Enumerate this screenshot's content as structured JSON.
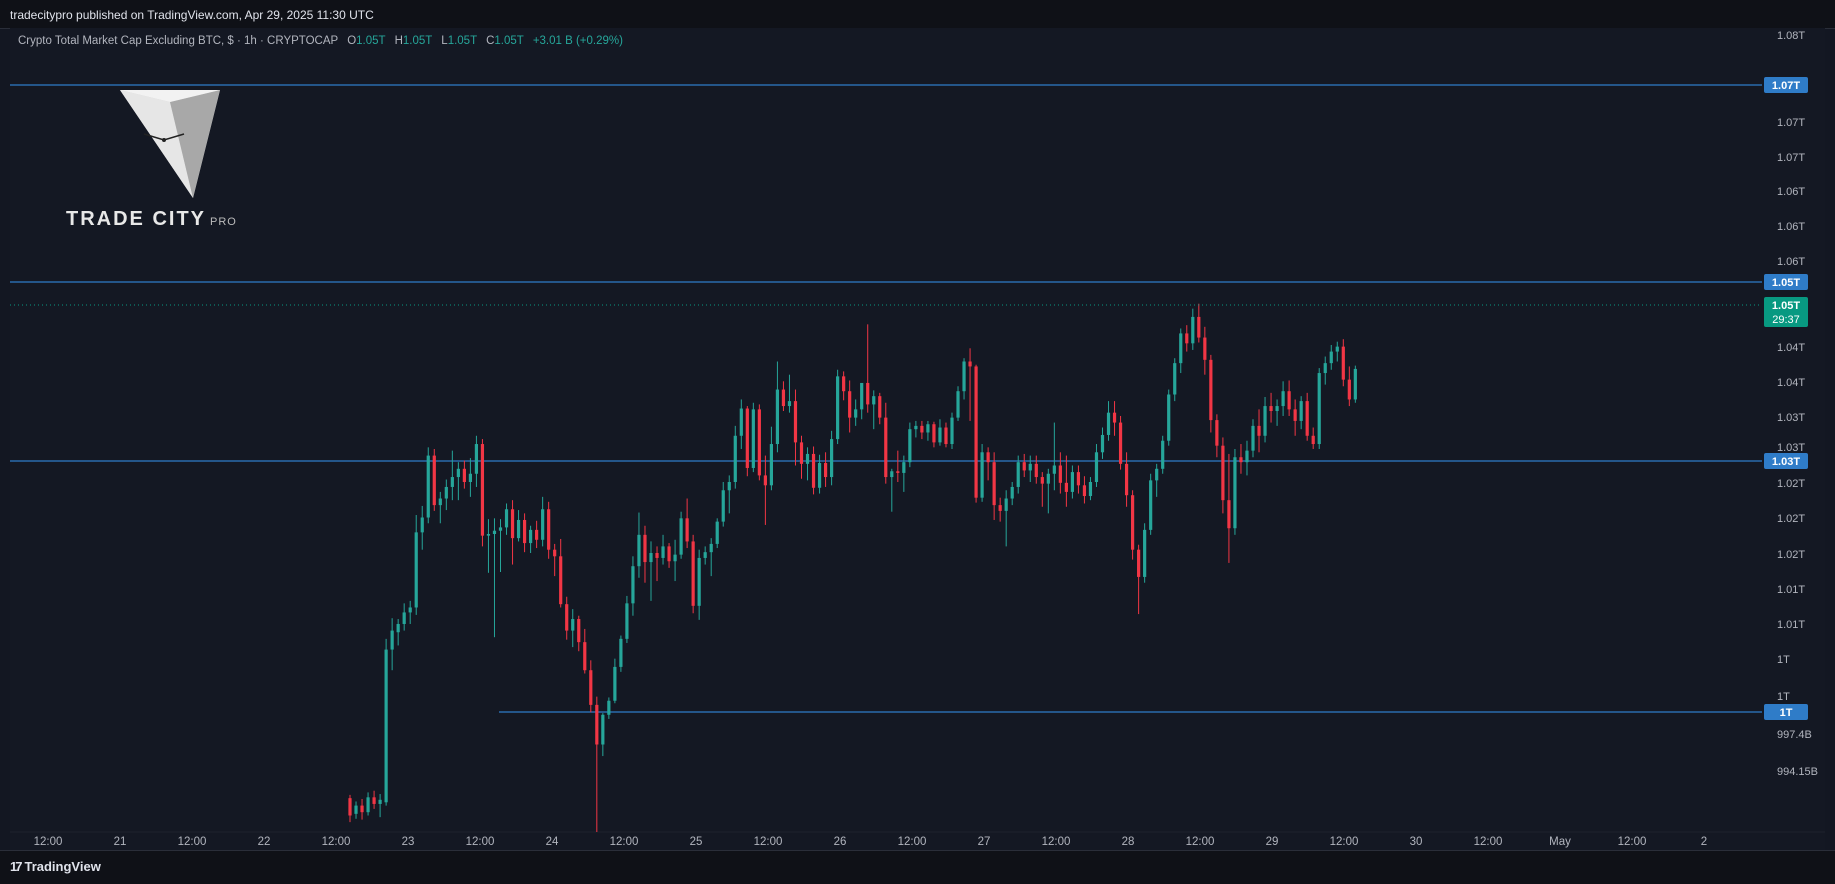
{
  "header": {
    "publisher": "tradecitypro published on TradingView.com, Apr 29, 2025 11:30 UTC"
  },
  "legend": {
    "symbol": "Crypto Total Market Cap Excluding BTC, $ · 1h · CRYPTOCAP",
    "o_label": "O",
    "o": "1.05T",
    "h_label": "H",
    "h": "1.05T",
    "l_label": "L",
    "l": "1.05T",
    "c_label": "C",
    "c": "1.05T",
    "change": "+3.01 B (+0.29%)"
  },
  "brand": {
    "name": "TRADE CITY",
    "sub": "PRO"
  },
  "footer": {
    "logo_text": "TradingView",
    "logo_mark": "17"
  },
  "colors": {
    "background": "#141823",
    "up": "#26a69a",
    "down": "#f23645",
    "level_line": "#2f7cc8",
    "label_blue": "#2f7cc8",
    "label_green": "#089981"
  },
  "chart_data": {
    "type": "candlestick",
    "title": "Crypto Total Market Cap Excluding BTC, $ · 1h · CRYPTOCAP",
    "x_tick_labels": [
      "12:00",
      "21",
      "12:00",
      "22",
      "12:00",
      "23",
      "12:00",
      "24",
      "12:00",
      "25",
      "12:00",
      "26",
      "12:00",
      "27",
      "12:00",
      "28",
      "12:00",
      "29",
      "12:00",
      "30",
      "12:00",
      "May",
      "12:00",
      "2"
    ],
    "y_tick_labels": [
      {
        "label": "1.08T",
        "value": 1.088
      },
      {
        "label": "1.08T",
        "value": 1.083
      },
      {
        "label": "1.07T",
        "value": 1.073
      },
      {
        "label": "1.07T",
        "value": 1.068
      },
      {
        "label": "1.06T",
        "value": 1.063
      },
      {
        "label": "1.06T",
        "value": 1.058
      },
      {
        "label": "1.06T",
        "value": 1.053
      },
      {
        "label": "1.05T",
        "value": 1.048
      },
      {
        "label": "1.04T",
        "value": 1.043
      },
      {
        "label": "1.04T",
        "value": 1.038
      },
      {
        "label": "1.03T",
        "value": 1.033
      },
      {
        "label": "1.03T",
        "value": 1.028
      },
      {
        "label": "1.02T",
        "value": 1.023
      },
      {
        "label": "1.02T",
        "value": 1.018
      },
      {
        "label": "1.02T",
        "value": 1.013
      },
      {
        "label": "1.01T",
        "value": 1.008
      },
      {
        "label": "1.01T",
        "value": 1.003
      },
      {
        "label": "1T",
        "value": 0.998
      },
      {
        "label": "1T",
        "value": 0.993
      },
      {
        "label": "997.4B",
        "value": 0.9974
      },
      {
        "label": "994.15B",
        "value": 0.99415
      }
    ],
    "horizontal_levels": [
      {
        "label": "1.07T",
        "value": 1.078,
        "start": "left"
      },
      {
        "label": "1.05T",
        "value": 1.051,
        "start": "left"
      },
      {
        "label": "1.03T",
        "value": 1.0265,
        "start": "left"
      },
      {
        "label": "1T",
        "value": 0.992,
        "start": "Apr 23 10:00"
      }
    ],
    "last_price": {
      "label": "1.05T",
      "countdown": "29:37",
      "value": 1.0477
    },
    "x_range_hours": [
      0,
      240
    ],
    "y_range": [
      0.9916,
      1.089
    ],
    "candles": [
      [
        60,
        0.9957,
        0.9961,
        0.9928,
        0.9936
      ],
      [
        61,
        0.9938,
        0.9953,
        0.9932,
        0.9948
      ],
      [
        62,
        0.9948,
        0.9956,
        0.9931,
        0.994
      ],
      [
        63,
        0.994,
        0.9964,
        0.9936,
        0.9958
      ],
      [
        64,
        0.9958,
        0.9966,
        0.9944,
        0.995
      ],
      [
        65,
        0.995,
        0.9962,
        0.9934,
        0.9955
      ],
      [
        66,
        0.9952,
        1.015,
        0.9948,
        1.0137
      ],
      [
        67,
        1.0137,
        1.0175,
        1.0112,
        1.016
      ],
      [
        68,
        1.0158,
        1.0174,
        1.0142,
        1.0168
      ],
      [
        69,
        1.0168,
        1.0193,
        1.016,
        1.0182
      ],
      [
        70,
        1.0182,
        1.0196,
        1.0168,
        1.0188
      ],
      [
        71,
        1.0188,
        1.03,
        1.0179,
        1.0279
      ],
      [
        72,
        1.0279,
        1.0311,
        1.0258,
        1.0297
      ],
      [
        73,
        1.0297,
        1.0382,
        1.029,
        1.0372
      ],
      [
        74,
        1.0372,
        1.038,
        1.0305,
        1.0312
      ],
      [
        75,
        1.0312,
        1.0328,
        1.029,
        1.032
      ],
      [
        76,
        1.032,
        1.0343,
        1.0306,
        1.0334
      ],
      [
        77,
        1.0334,
        1.0378,
        1.0318,
        1.0346
      ],
      [
        78,
        1.0346,
        1.0364,
        1.0318,
        1.0356
      ],
      [
        79,
        1.0356,
        1.0366,
        1.0332,
        1.034
      ],
      [
        80,
        1.034,
        1.0369,
        1.0322,
        1.035
      ],
      [
        81,
        1.035,
        1.0396,
        1.0334,
        1.0386
      ],
      [
        82,
        1.0386,
        1.0392,
        1.0262,
        1.0275
      ],
      [
        83,
        1.0275,
        1.0295,
        1.023,
        1.0277
      ],
      [
        84,
        1.0277,
        1.0296,
        1.0152,
        1.0281
      ],
      [
        85,
        1.0281,
        1.0295,
        1.0231,
        1.0285
      ],
      [
        86,
        1.0285,
        1.0314,
        1.0276,
        1.0307
      ],
      [
        87,
        1.0307,
        1.0318,
        1.024,
        1.0272
      ],
      [
        88,
        1.0272,
        1.0306,
        1.0268,
        1.0294
      ],
      [
        89,
        1.0294,
        1.0302,
        1.0255,
        1.0266
      ],
      [
        90,
        1.0266,
        1.0287,
        1.0254,
        1.0282
      ],
      [
        91,
        1.0282,
        1.0293,
        1.026,
        1.027
      ],
      [
        92,
        1.027,
        1.0322,
        1.0262,
        1.0307
      ],
      [
        93,
        1.0307,
        1.0316,
        1.0247,
        1.0258
      ],
      [
        94,
        1.0258,
        1.0265,
        1.0226,
        1.025
      ],
      [
        95,
        1.025,
        1.0271,
        1.0188,
        1.0192
      ],
      [
        96,
        1.0192,
        1.0201,
        1.0149,
        1.016
      ],
      [
        97,
        1.016,
        1.0186,
        1.014,
        1.0174
      ],
      [
        98,
        1.0174,
        1.0178,
        1.0135,
        1.0146
      ],
      [
        99,
        1.0146,
        1.0162,
        1.0108,
        1.0112
      ],
      [
        100,
        1.0112,
        1.0124,
        1.0061,
        1.007
      ],
      [
        101,
        1.007,
        1.008,
        0.9916,
        1.0022
      ],
      [
        102,
        1.0022,
        1.006,
        1.0008,
        1.0058
      ],
      [
        103,
        1.0058,
        1.0079,
        1.0053,
        1.0075
      ],
      [
        104,
        1.0075,
        1.0126,
        1.0072,
        1.0116
      ],
      [
        105,
        1.0116,
        1.0154,
        1.011,
        1.015
      ],
      [
        106,
        1.015,
        1.0202,
        1.0145,
        1.0193
      ],
      [
        107,
        1.0193,
        1.025,
        1.0178,
        1.0238
      ],
      [
        108,
        1.0238,
        1.0303,
        1.0224,
        1.0276
      ],
      [
        109,
        1.0276,
        1.0287,
        1.0218,
        1.0243
      ],
      [
        110,
        1.0243,
        1.0268,
        1.0196,
        1.0254
      ],
      [
        111,
        1.0254,
        1.0262,
        1.022,
        1.0248
      ],
      [
        112,
        1.0248,
        1.0276,
        1.024,
        1.0262
      ],
      [
        113,
        1.0262,
        1.0266,
        1.0236,
        1.0244
      ],
      [
        114,
        1.0244,
        1.027,
        1.022,
        1.0252
      ],
      [
        115,
        1.0252,
        1.0304,
        1.0247,
        1.0296
      ],
      [
        116,
        1.0296,
        1.032,
        1.026,
        1.0268
      ],
      [
        117,
        1.0268,
        1.0276,
        1.0181,
        1.019
      ],
      [
        118,
        1.019,
        1.0258,
        1.0173,
        1.0248
      ],
      [
        119,
        1.0248,
        1.0262,
        1.024,
        1.0255
      ],
      [
        120,
        1.0255,
        1.0272,
        1.0226,
        1.0265
      ],
      [
        121,
        1.0265,
        1.0296,
        1.026,
        1.0292
      ],
      [
        122,
        1.0292,
        1.034,
        1.0286,
        1.033
      ],
      [
        123,
        1.033,
        1.0348,
        1.0302,
        1.034
      ],
      [
        124,
        1.034,
        1.0408,
        1.0332,
        1.0396
      ],
      [
        125,
        1.0396,
        1.044,
        1.038,
        1.0429
      ],
      [
        126,
        1.0429,
        1.0432,
        1.0347,
        1.0357
      ],
      [
        127,
        1.0357,
        1.0436,
        1.0352,
        1.0428
      ],
      [
        128,
        1.0428,
        1.0434,
        1.0342,
        1.0348
      ],
      [
        129,
        1.0348,
        1.0372,
        1.0288,
        1.0336
      ],
      [
        130,
        1.0336,
        1.0407,
        1.033,
        1.0386
      ],
      [
        131,
        1.0386,
        1.0486,
        1.0376,
        1.0452
      ],
      [
        132,
        1.0452,
        1.0462,
        1.0426,
        1.0432
      ],
      [
        133,
        1.0432,
        1.047,
        1.0424,
        1.0438
      ],
      [
        134,
        1.0438,
        1.0452,
        1.036,
        1.0388
      ],
      [
        135,
        1.0388,
        1.0396,
        1.0344,
        1.0362
      ],
      [
        136,
        1.0362,
        1.0382,
        1.0342,
        1.0374
      ],
      [
        137,
        1.0374,
        1.0383,
        1.0325,
        1.0333
      ],
      [
        138,
        1.0333,
        1.0373,
        1.0326,
        1.0363
      ],
      [
        139,
        1.0363,
        1.0376,
        1.0334,
        1.0346
      ],
      [
        140,
        1.0346,
        1.0402,
        1.0336,
        1.0392
      ],
      [
        141,
        1.0392,
        1.0476,
        1.0386,
        1.0468
      ],
      [
        142,
        1.0468,
        1.0474,
        1.0439,
        1.045
      ],
      [
        143,
        1.045,
        1.0463,
        1.04,
        1.0418
      ],
      [
        144,
        1.0418,
        1.044,
        1.0408,
        1.0428
      ],
      [
        145,
        1.0428,
        1.045,
        1.0416,
        1.046
      ],
      [
        146,
        1.046,
        1.0531,
        1.0424,
        1.0434
      ],
      [
        147,
        1.0434,
        1.0451,
        1.0404,
        1.0444
      ],
      [
        148,
        1.0444,
        1.0448,
        1.041,
        1.0418
      ],
      [
        149,
        1.0418,
        1.0436,
        1.0338,
        1.0346
      ],
      [
        150,
        1.0346,
        1.0356,
        1.0304,
        1.0353
      ],
      [
        151,
        1.0353,
        1.0378,
        1.034,
        1.0351
      ],
      [
        152,
        1.0351,
        1.0372,
        1.0328,
        1.0364
      ],
      [
        153,
        1.0364,
        1.0412,
        1.0358,
        1.0404
      ],
      [
        154,
        1.0404,
        1.0414,
        1.0394,
        1.0408
      ],
      [
        155,
        1.0408,
        1.0414,
        1.0392,
        1.04
      ],
      [
        156,
        1.04,
        1.0414,
        1.039,
        1.041
      ],
      [
        157,
        1.041,
        1.0413,
        1.0382,
        1.0388
      ],
      [
        158,
        1.0388,
        1.0416,
        1.0384,
        1.0406
      ],
      [
        159,
        1.0406,
        1.0412,
        1.0382,
        1.0386
      ],
      [
        160,
        1.0386,
        1.0424,
        1.038,
        1.0418
      ],
      [
        161,
        1.0418,
        1.0456,
        1.0414,
        1.045
      ],
      [
        162,
        1.045,
        1.049,
        1.044,
        1.0486
      ],
      [
        163,
        1.0486,
        1.0502,
        1.0414,
        1.048
      ],
      [
        164,
        1.048,
        1.0482,
        1.0315,
        1.0321
      ],
      [
        165,
        1.0321,
        1.0386,
        1.0316,
        1.0376
      ],
      [
        166,
        1.0376,
        1.0382,
        1.0342,
        1.0364
      ],
      [
        167,
        1.0364,
        1.0376,
        1.0294,
        1.0312
      ],
      [
        168,
        1.0312,
        1.0321,
        1.0292,
        1.0305
      ],
      [
        169,
        1.0305,
        1.033,
        1.0262,
        1.032
      ],
      [
        170,
        1.032,
        1.034,
        1.0312,
        1.0334
      ],
      [
        171,
        1.0334,
        1.0372,
        1.0326,
        1.0364
      ],
      [
        172,
        1.0364,
        1.0374,
        1.0346,
        1.0354
      ],
      [
        173,
        1.0354,
        1.0372,
        1.034,
        1.0362
      ],
      [
        174,
        1.0362,
        1.0372,
        1.0338,
        1.0346
      ],
      [
        175,
        1.0346,
        1.0352,
        1.031,
        1.0338
      ],
      [
        176,
        1.0338,
        1.0356,
        1.0302,
        1.035
      ],
      [
        177,
        1.035,
        1.0412,
        1.033,
        1.036
      ],
      [
        178,
        1.036,
        1.0376,
        1.0326,
        1.0339
      ],
      [
        179,
        1.0339,
        1.0372,
        1.031,
        1.0328
      ],
      [
        180,
        1.0328,
        1.036,
        1.032,
        1.0352
      ],
      [
        181,
        1.0352,
        1.036,
        1.0326,
        1.0336
      ],
      [
        182,
        1.0336,
        1.0347,
        1.0314,
        1.0323
      ],
      [
        183,
        1.0323,
        1.0346,
        1.0318,
        1.034
      ],
      [
        184,
        1.034,
        1.0386,
        1.0334,
        1.0376
      ],
      [
        185,
        1.0376,
        1.0406,
        1.0368,
        1.0397
      ],
      [
        186,
        1.0397,
        1.0438,
        1.039,
        1.0424
      ],
      [
        187,
        1.0424,
        1.0438,
        1.0396,
        1.0412
      ],
      [
        188,
        1.0412,
        1.042,
        1.0355,
        1.0362
      ],
      [
        189,
        1.0362,
        1.0376,
        1.031,
        1.0324
      ],
      [
        190,
        1.0324,
        1.033,
        1.0246,
        1.0258
      ],
      [
        191,
        1.0258,
        1.0264,
        1.018,
        1.0225
      ],
      [
        192,
        1.0225,
        1.029,
        1.0218,
        1.0282
      ],
      [
        193,
        1.0282,
        1.035,
        1.0276,
        1.0342
      ],
      [
        194,
        1.0342,
        1.0362,
        1.0322,
        1.0356
      ],
      [
        195,
        1.0356,
        1.0396,
        1.035,
        1.039
      ],
      [
        196,
        1.039,
        1.0452,
        1.0384,
        1.0446
      ],
      [
        197,
        1.0446,
        1.049,
        1.0438,
        1.0484
      ],
      [
        198,
        1.0484,
        1.0526,
        1.0472,
        1.052
      ],
      [
        199,
        1.052,
        1.053,
        1.0498,
        1.0508
      ],
      [
        200,
        1.0508,
        1.055,
        1.05,
        1.054
      ],
      [
        201,
        1.054,
        1.0556,
        1.0509,
        1.0515
      ],
      [
        202,
        1.0515,
        1.0528,
        1.047,
        1.0488
      ],
      [
        203,
        1.0488,
        1.0494,
        1.04,
        1.0415
      ],
      [
        204,
        1.0415,
        1.0422,
        1.037,
        1.0384
      ],
      [
        205,
        1.0384,
        1.0394,
        1.0302,
        1.0318
      ],
      [
        206,
        1.0318,
        1.0374,
        1.0242,
        1.0284
      ],
      [
        207,
        1.0284,
        1.038,
        1.0276,
        1.037
      ],
      [
        208,
        1.037,
        1.0386,
        1.035,
        1.0364
      ],
      [
        209,
        1.0364,
        1.039,
        1.0348,
        1.0378
      ],
      [
        210,
        1.0378,
        1.0416,
        1.037,
        1.0408
      ],
      [
        211,
        1.0408,
        1.0428,
        1.0376,
        1.0396
      ],
      [
        212,
        1.0396,
        1.0443,
        1.0388,
        1.0432
      ],
      [
        213,
        1.0432,
        1.0448,
        1.0412,
        1.0426
      ],
      [
        214,
        1.0426,
        1.044,
        1.0408,
        1.0432
      ],
      [
        215,
        1.0432,
        1.0462,
        1.042,
        1.045
      ],
      [
        216,
        1.045,
        1.0463,
        1.042,
        1.0428
      ],
      [
        217,
        1.0428,
        1.044,
        1.0396,
        1.0414
      ],
      [
        218,
        1.0414,
        1.0444,
        1.0404,
        1.0438
      ],
      [
        219,
        1.0438,
        1.0448,
        1.039,
        1.0396
      ],
      [
        220,
        1.0396,
        1.0406,
        1.038,
        1.0386
      ],
      [
        221,
        1.0386,
        1.0478,
        1.038,
        1.0472
      ],
      [
        222,
        1.0472,
        1.0492,
        1.0458,
        1.0484
      ],
      [
        223,
        1.0484,
        1.0506,
        1.0476,
        1.0498
      ],
      [
        224,
        1.0498,
        1.051,
        1.0486,
        1.0504
      ],
      [
        225,
        1.0504,
        1.0513,
        1.0456,
        1.0464
      ],
      [
        226,
        1.0464,
        1.048,
        1.0432,
        1.044
      ],
      [
        227,
        1.044,
        1.0481,
        1.0436,
        1.0477
      ]
    ]
  }
}
